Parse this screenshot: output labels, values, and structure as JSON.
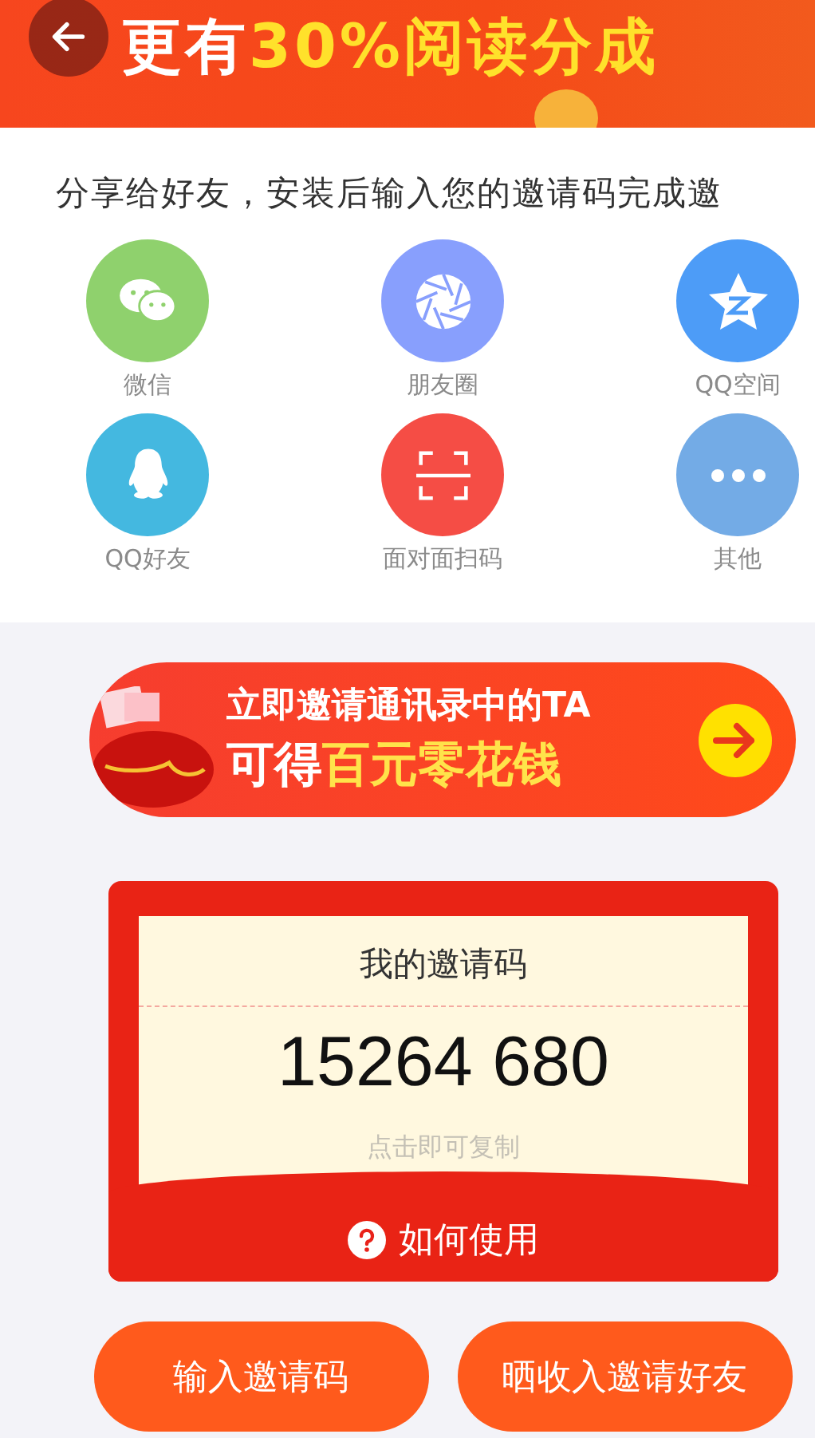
{
  "header": {
    "headline_white": "更有",
    "headline_yellow": "30%阅读分成"
  },
  "intro": "分享给好友，安装后输入您的邀请码完成邀",
  "share_options": [
    {
      "kind": "wechat",
      "label": "微信",
      "color": "#8fd16d"
    },
    {
      "kind": "moments",
      "label": "朋友圈",
      "color": "#889ffd"
    },
    {
      "kind": "qzone",
      "label": "QQ空间",
      "color": "#4d9cf7"
    },
    {
      "kind": "qq",
      "label": "QQ好友",
      "color": "#44b8e0"
    },
    {
      "kind": "scan",
      "label": "面对面扫码",
      "color": "#f54d45"
    },
    {
      "kind": "more",
      "label": "其他",
      "color": "#73abe6"
    }
  ],
  "promo_banner": {
    "line_1": "立即邀请通讯录中的TA",
    "line_2_prefix": "可得",
    "line_2_highlight": "百元零花钱"
  },
  "invite_card": {
    "title": "我的邀请码",
    "code": "15264 680",
    "hint": "点击即可复制",
    "help": "如何使用"
  },
  "buttons": [
    "输入邀请码",
    "晒收入邀请好友"
  ]
}
